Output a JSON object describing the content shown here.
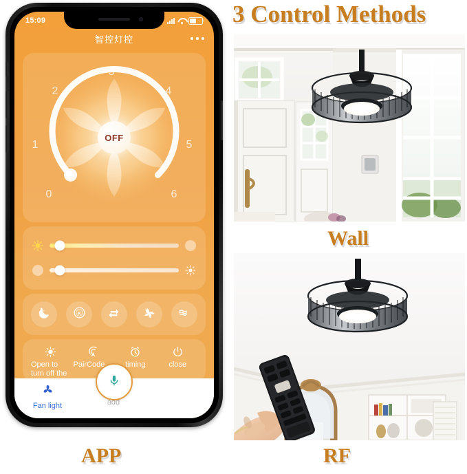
{
  "captions": {
    "title": "3 Control Methods",
    "wall": "Wall",
    "app": "APP",
    "rf": "RF"
  },
  "phone": {
    "status_bar": {
      "time": "15:09",
      "signal_icon": "cellular-signal-icon",
      "wifi_icon": "wifi-icon",
      "battery_icon": "battery-icon"
    },
    "app_header": {
      "title": "智控灯控",
      "menu_icon": "more-dots-icon"
    },
    "fan_dial": {
      "center_label": "OFF",
      "ticks": [
        "0",
        "1",
        "2",
        "3",
        "4",
        "5",
        "6"
      ],
      "current_value": "0",
      "min": "0",
      "max": "6"
    },
    "sliders": [
      {
        "name": "brightness-slider",
        "left_icon": "sun-bright-icon",
        "right_icon": "dot-icon",
        "value_percent": 8
      },
      {
        "name": "color-temperature-slider",
        "left_icon": "dot-icon",
        "right_icon": "sun-small-icon",
        "value_percent": 8
      }
    ],
    "scene_buttons": [
      {
        "name": "night-mode-button",
        "icon": "moon-stars-icon"
      },
      {
        "name": "kelvin-mode-button",
        "icon": "kelvin-circle-icon"
      },
      {
        "name": "reverse-button",
        "icon": "reverse-arrows-icon"
      },
      {
        "name": "fan-speed-button",
        "icon": "fan-spiral-icon"
      },
      {
        "name": "breeze-button",
        "icon": "wave-lines-icon"
      }
    ],
    "function_buttons": [
      {
        "name": "turn-off-light-button",
        "icon": "bulb-icon",
        "label": "Open to turn off the lights"
      },
      {
        "name": "pair-code-button",
        "icon": "signal-pair-icon",
        "label": "PairCode"
      },
      {
        "name": "timing-button",
        "icon": "alarm-clock-icon",
        "label": "timing"
      },
      {
        "name": "close-button",
        "icon": "power-icon",
        "label": "close"
      }
    ],
    "voice_button": {
      "name": "voice-mic-button",
      "icon": "microphone-icon"
    },
    "tabbar": [
      {
        "name": "tab-fan-light",
        "icon": "fan-icon",
        "label": "Fan light",
        "active": true
      },
      {
        "name": "tab-add",
        "icon": "plus-circle-icon",
        "label": "add",
        "active": false
      }
    ]
  },
  "photos": {
    "wall": {
      "alt": "ceiling fan chandelier in white entryway with wall switch"
    },
    "rf": {
      "alt": "hand holding rf remote pointing at crystal ceiling fan"
    }
  },
  "colors": {
    "accent_orange": "#f0a143",
    "caption_gold": "#c87d1e",
    "tab_active_blue": "#3a6fd8",
    "mic_teal": "#2aa79a",
    "off_text": "#8e3a2a"
  }
}
